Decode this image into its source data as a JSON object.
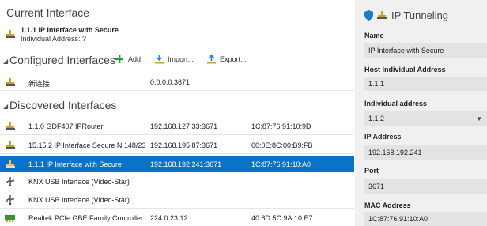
{
  "current": {
    "heading": "Current Interface",
    "name": "1.1.1 IP Interface with Secure",
    "address_line": "Individual Address: ?"
  },
  "configured": {
    "heading": "Configured Interfaces",
    "add_label": "Add",
    "import_label": "Import...",
    "export_label": "Export...",
    "rows": [
      {
        "name": "新连接",
        "address": "0.0.0.0:3671"
      }
    ]
  },
  "discovered": {
    "heading": "Discovered Interfaces",
    "rows": [
      {
        "name": "1.1.0 GDF407 IPRouter",
        "address": "192.168.127.33:3671",
        "mac": "1C:87:76:91:10:9D",
        "icon": "network-plug-icon"
      },
      {
        "name": "15.15.2 IP Interface Secure N 148/23",
        "address": "192.168.195.87:3671",
        "mac": "00:0E:8C:00:B9:FB",
        "icon": "network-plug-icon"
      },
      {
        "name": "1.1.1 IP Interface with Secure",
        "address": "192.168.192.241:3671",
        "mac": "1C:87:76:91:10:A0",
        "icon": "network-plug-icon",
        "selected": true
      },
      {
        "name": "KNX USB Interface (Video-Star)",
        "address": "",
        "mac": "",
        "icon": "usb-icon"
      },
      {
        "name": "KNX USB Interface (Video-Star)",
        "address": "",
        "mac": "",
        "icon": "usb-icon"
      },
      {
        "name": "Realtek PCIe GBE Family Controller",
        "address": "224.0.23.12",
        "mac": "40:8D:5C:9A:10:E7",
        "icon": "network-card-icon"
      }
    ]
  },
  "panel": {
    "title": "IP Tunneling",
    "name_label": "Name",
    "name_value": "IP Interface with Secure",
    "host_label": "Host Individual Address",
    "host_value": "1.1.1",
    "ind_label": "Individual address",
    "ind_value": "1.1.2",
    "ip_label": "IP Address",
    "ip_value": "192.168.192.241",
    "port_label": "Port",
    "port_value": "3671",
    "mac_label": "MAC Address",
    "mac_value": "1C:87:76:91:10:A0"
  },
  "colors": {
    "selection": "#0b72c9",
    "accent_green": "#2f9e3a",
    "accent_blue": "#2b7cd3",
    "shield_blue": "#1f78c8",
    "plug_gold": "#c9a227"
  }
}
